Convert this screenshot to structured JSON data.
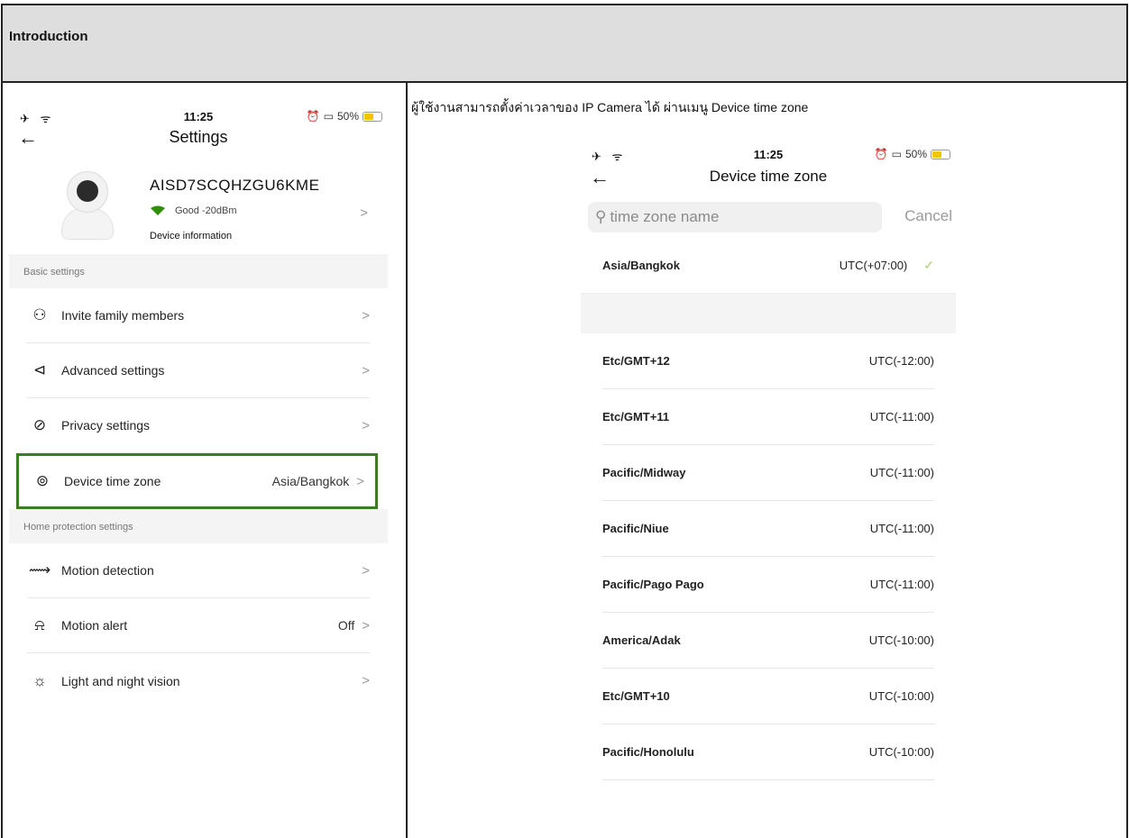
{
  "doc": {
    "header": "Introduction",
    "caption": "ผู้ใช้งานสามารถตั้งค่าเวลาของ IP Camera ได้ ผ่านเมนู Device time zone"
  },
  "colors": {
    "highlight": "#3d7c25",
    "battery": "#f2c500",
    "check": "#a8d06a",
    "wifi": "#2f8f0a"
  },
  "status": {
    "icons_left": "✈ ᯤ",
    "time": "11:25",
    "battery": "50%"
  },
  "settings": {
    "back_icon": "arrow-left-icon",
    "title": "Settings",
    "device": {
      "name": "AISD7SCQHZGU6KME",
      "signal": "Good -20dBm",
      "info": "Device information"
    },
    "sections": [
      {
        "label": "Basic settings",
        "items": [
          {
            "label": "Invite family members",
            "value": "",
            "icon": "family-icon",
            "glyph": "⚇"
          },
          {
            "label": "Advanced settings",
            "value": "",
            "icon": "speaker-icon",
            "glyph": "⊲"
          },
          {
            "label": "Privacy settings",
            "value": "",
            "icon": "eye-off-icon",
            "glyph": "⊘"
          },
          {
            "label": "Device time zone",
            "value": "Asia/Bangkok",
            "icon": "location-icon",
            "glyph": "⊚"
          }
        ]
      },
      {
        "label": "Home protection settings",
        "items": [
          {
            "label": "Motion detection",
            "value": "",
            "icon": "motion-icon",
            "glyph": "⟿"
          },
          {
            "label": "Motion alert",
            "value": "Off",
            "icon": "alarm-icon",
            "glyph": "⍾"
          },
          {
            "label": "Light and night vision",
            "value": "",
            "icon": "sun-moon-icon",
            "glyph": "☼"
          }
        ]
      }
    ]
  },
  "timezone_screen": {
    "title": "Device time zone",
    "search_placeholder": "time zone name",
    "cancel": "Cancel",
    "selected": {
      "name": "Asia/Bangkok",
      "utc": "UTC(+07:00)"
    },
    "zones": [
      {
        "name": "Etc/GMT+12",
        "utc": "UTC(-12:00)"
      },
      {
        "name": "Etc/GMT+11",
        "utc": "UTC(-11:00)"
      },
      {
        "name": "Pacific/Midway",
        "utc": "UTC(-11:00)"
      },
      {
        "name": "Pacific/Niue",
        "utc": "UTC(-11:00)"
      },
      {
        "name": "Pacific/Pago Pago",
        "utc": "UTC(-11:00)"
      },
      {
        "name": "America/Adak",
        "utc": "UTC(-10:00)"
      },
      {
        "name": "Etc/GMT+10",
        "utc": "UTC(-10:00)"
      },
      {
        "name": "Pacific/Honolulu",
        "utc": "UTC(-10:00)"
      }
    ]
  }
}
